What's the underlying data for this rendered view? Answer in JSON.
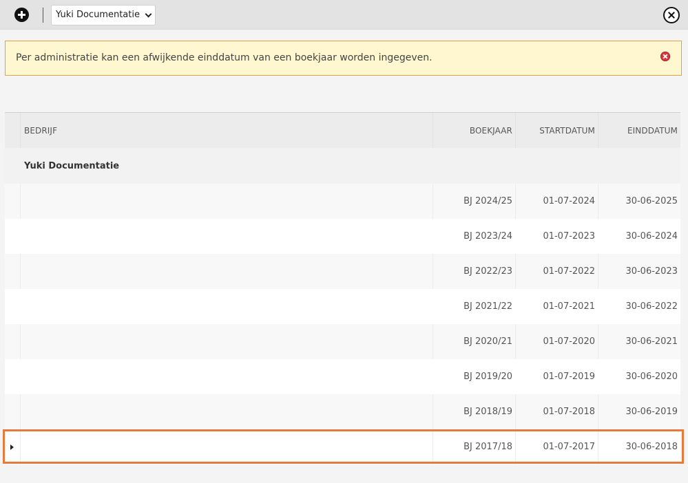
{
  "toolbar": {
    "add_icon": "plus-circle-icon",
    "company_selector": "Yuki Documentatie",
    "close_icon": "close-circle-icon"
  },
  "notice": {
    "text": "Per administratie kan een afwijkende einddatum van een boekjaar worden ingegeven.",
    "dismiss_icon": "close-circle-icon",
    "color": "#fff7cf",
    "border_color": "#e89c45"
  },
  "table": {
    "columns": {
      "company": "BEDRIJF",
      "year": "BOEKJAAR",
      "start": "STARTDATUM",
      "end": "EINDDATUM"
    },
    "group_label": "Yuki Documentatie",
    "rows": [
      {
        "year": "BJ 2024/25",
        "start": "01-07-2024",
        "end": "30-06-2025"
      },
      {
        "year": "BJ 2023/24",
        "start": "01-07-2023",
        "end": "30-06-2024"
      },
      {
        "year": "BJ 2022/23",
        "start": "01-07-2022",
        "end": "30-06-2023"
      },
      {
        "year": "BJ 2021/22",
        "start": "01-07-2021",
        "end": "30-06-2022"
      },
      {
        "year": "BJ 2020/21",
        "start": "01-07-2020",
        "end": "30-06-2021"
      },
      {
        "year": "BJ 2019/20",
        "start": "01-07-2019",
        "end": "30-06-2020"
      },
      {
        "year": "BJ 2018/19",
        "start": "01-07-2018",
        "end": "30-06-2019"
      },
      {
        "year": "BJ 2017/18",
        "start": "01-07-2017",
        "end": "30-06-2018"
      }
    ],
    "selected_outline_color": "#e57a3c"
  }
}
